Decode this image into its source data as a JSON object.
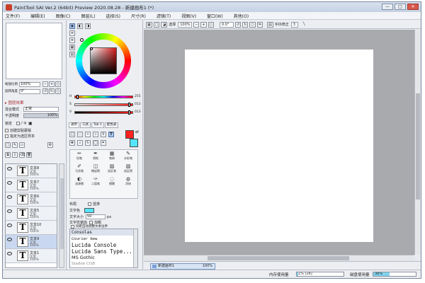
{
  "window": {
    "title": "PaintTool SAI Ver.2 (64bit) Preview 2020.08.28 - 新建画布1 (*)",
    "btn_min": "—",
    "btn_max": "□",
    "btn_close": "✕"
  },
  "menu": [
    "文件(F)",
    "编辑(E)",
    "图像(C)",
    "图层(L)",
    "选择(S)",
    "尺寸(R)",
    "滤镜(T)",
    "视图(V)",
    "窗口(W)",
    "其他(O)"
  ],
  "navigator": {
    "zoom_label": "缩放比例",
    "zoom_value": "100%",
    "angle_label": "旋转角度",
    "angle_value": "0°"
  },
  "layer_props": {
    "section": "▸ 图层效果",
    "blend_label": "混合模式",
    "blend_value": "正常",
    "opacity_label": "不透明度",
    "opacity_value": "100%",
    "lock_label": "锁定",
    "clip_label": "创建剪贴蒙版",
    "ref_label": "指定为选区样本"
  },
  "layers": [
    {
      "name": "文本8",
      "mode": "正常",
      "opacity": "100%",
      "selected": false
    },
    {
      "name": "文本7",
      "mode": "正常",
      "opacity": "100%",
      "selected": false
    },
    {
      "name": "文本6",
      "mode": "正常",
      "opacity": "100%",
      "selected": false
    },
    {
      "name": "文本5",
      "mode": "正常",
      "opacity": "100%",
      "selected": false
    },
    {
      "name": "文本10",
      "mode": "正常",
      "opacity": "100%",
      "selected": false
    },
    {
      "name": "文本9",
      "mode": "正常",
      "opacity": "100%",
      "selected": true
    },
    {
      "name": "文本1",
      "mode": "正常",
      "opacity": "100%",
      "selected": false
    }
  ],
  "color": {
    "primary": "#ff2020",
    "secondary": "#55e6ff",
    "sliders": [
      {
        "label": "H",
        "value": "255",
        "gradient": "linear-gradient(to right,#ff0000,#ffff00,#00ff00,#00ffff,#0000ff,#ff00ff,#ff0000)",
        "pos": 0.02
      },
      {
        "label": "S",
        "value": "013",
        "gradient": "linear-gradient(to right,#ddd,#ff1a1a)",
        "pos": 0.95
      },
      {
        "label": "V",
        "value": "013",
        "gradient": "linear-gradient(to right,#000,#ff1a1a)",
        "pos": 0.95
      }
    ],
    "tabs": [
      "通用",
      "工具",
      "Tab 1",
      "配色表"
    ]
  },
  "tools": [
    {
      "icon": "✏",
      "label": "铅笔"
    },
    {
      "icon": "✒",
      "label": "喷枪"
    },
    {
      "icon": "▦",
      "label": "笔刷"
    },
    {
      "icon": "✎",
      "label": "水彩笔"
    },
    {
      "icon": "✐",
      "label": "马克笔"
    },
    {
      "icon": "◫",
      "label": "橡皮擦"
    },
    {
      "icon": "▨",
      "label": "选区笔"
    },
    {
      "icon": "▧",
      "label": "选区擦"
    },
    {
      "icon": "◐",
      "label": "油漆桶"
    },
    {
      "icon": "✑",
      "label": "二值笔"
    },
    {
      "icon": "◌",
      "label": "模糊"
    },
    {
      "icon": "◍",
      "label": "涂抹"
    }
  ],
  "text_tool": {
    "orientation_label": "布局",
    "vertical_label": "竖排",
    "color_label": "文字色",
    "size_label": "文字大小",
    "size_value": "50",
    "size_unit": "px",
    "antialias_label": "文字抗锯齿",
    "bold_label": "加粗",
    "fit_label": "间距自动调整文本边界"
  },
  "fonts": [
    "Consolas",
    "Courier New",
    "Lucida Console",
    "Lucida Sans Type...",
    "MS Gothic",
    "Siadon CtlB"
  ],
  "canvas_toolbar": {
    "select_label": "选择",
    "zoom_value": "100%",
    "angle_value": "0.0°",
    "stabilizer_label": "手抖修正",
    "stabilizer_value": "3"
  },
  "document_tab": {
    "name": "新建画布1",
    "zoom": "100%"
  },
  "status": {
    "mem_label": "内存使用量",
    "mem_value": "1% (26)",
    "mem_pct": 0.03,
    "disk_label": "磁盘使用量",
    "disk_value": "38%",
    "disk_pct": 0.38
  }
}
